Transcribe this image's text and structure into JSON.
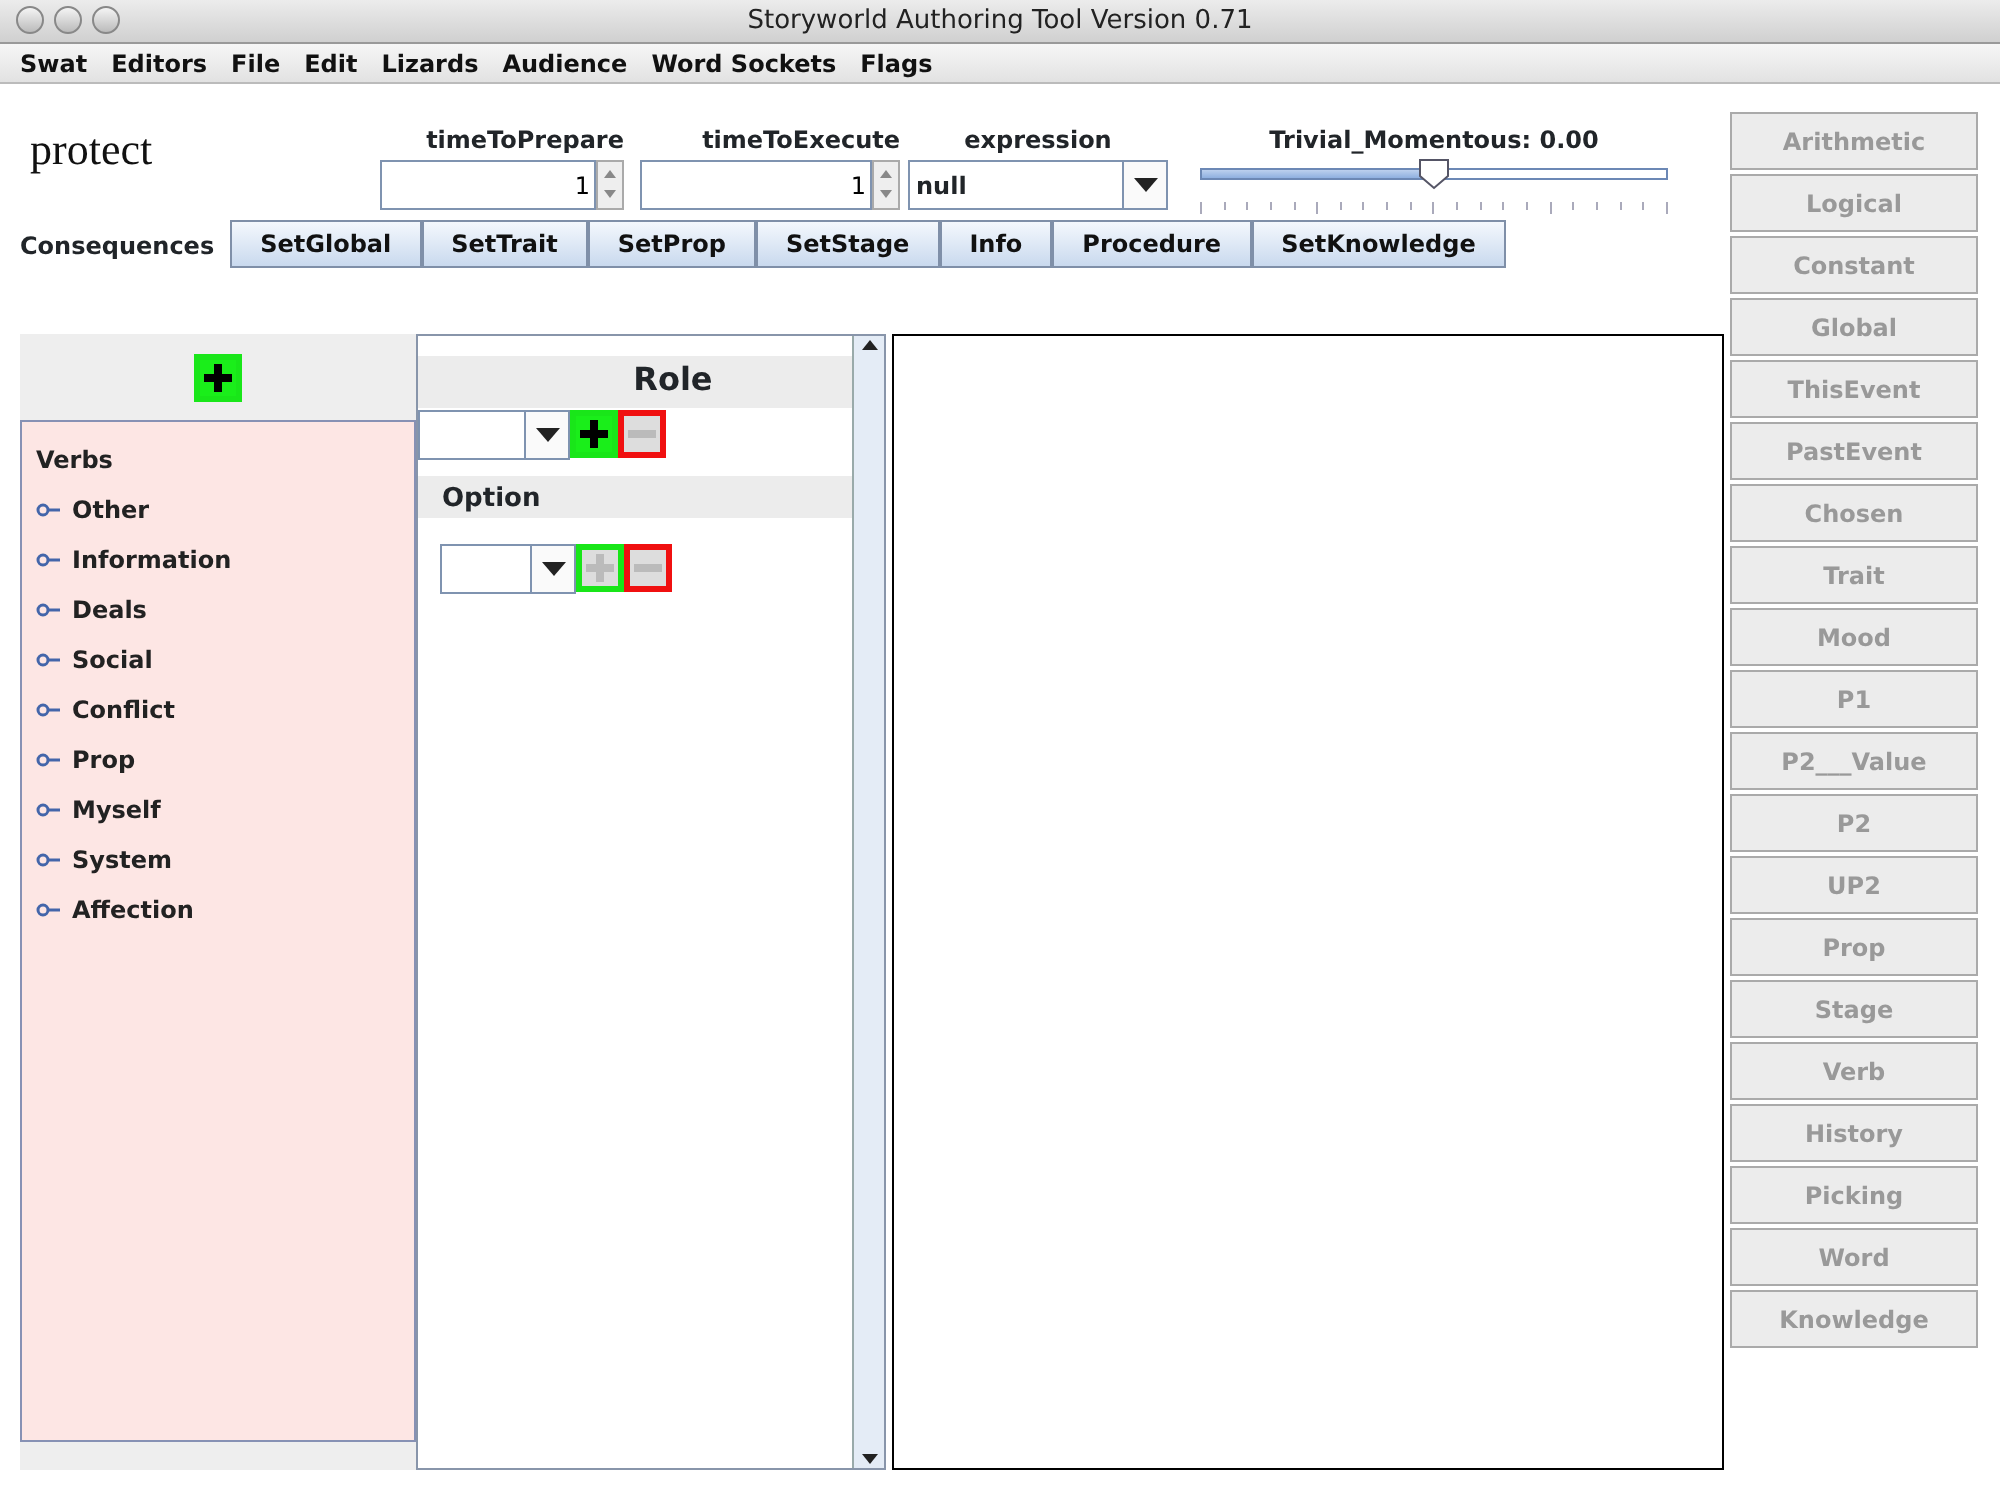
{
  "window": {
    "title": "Storyworld Authoring Tool Version 0.71"
  },
  "menu": [
    "Swat",
    "Editors",
    "File",
    "Edit",
    "Lizards",
    "Audience",
    "Word Sockets",
    "Flags"
  ],
  "verb_name": "protect",
  "fields": [
    {
      "kind": "spinner",
      "label": "timeToPrepare",
      "value": "1"
    },
    {
      "kind": "spinner",
      "label": "timeToExecute",
      "value": "1"
    },
    {
      "kind": "combo",
      "label": "expression",
      "value": "null"
    }
  ],
  "slider": {
    "label": "Trivial_Momentous: 0.00",
    "level": 0.5
  },
  "consequences": {
    "label": "Consequences",
    "buttons": [
      "SetGlobal",
      "SetTrait",
      "SetProp",
      "SetStage",
      "Info",
      "Procedure",
      "SetKnowledge"
    ]
  },
  "tree": {
    "root": "Verbs",
    "children": [
      {
        "label": "Other",
        "expanded": false
      },
      {
        "label": "Information",
        "expanded": false
      },
      {
        "label": "Deals",
        "expanded": false
      },
      {
        "label": "Social",
        "expanded": false
      },
      {
        "label": "Conflict",
        "expanded": false
      },
      {
        "label": "Prop",
        "expanded": false
      },
      {
        "label": "Myself",
        "expanded": false
      },
      {
        "label": "System",
        "expanded": false
      },
      {
        "label": "Affection",
        "expanded": false
      }
    ]
  },
  "sections": [
    {
      "title": "Role",
      "add_disabled": false,
      "remove_disabled": true
    },
    {
      "title": "Option",
      "add_disabled": true,
      "remove_disabled": true
    }
  ],
  "operators": [
    {
      "label": "Arithmetic",
      "disabled": true
    },
    {
      "label": "Logical",
      "disabled": true
    },
    {
      "label": "Constant",
      "disabled": true
    },
    {
      "label": "Global",
      "disabled": true
    },
    {
      "label": "ThisEvent",
      "disabled": true
    },
    {
      "label": "PastEvent",
      "disabled": true
    },
    {
      "label": "Chosen",
      "disabled": true
    },
    {
      "label": "Trait",
      "disabled": true
    },
    {
      "label": "Mood",
      "disabled": true
    },
    {
      "label": "P1",
      "disabled": true
    },
    {
      "label": "P2___Value",
      "disabled": true
    },
    {
      "label": "P2",
      "disabled": true
    },
    {
      "label": "UP2",
      "disabled": true
    },
    {
      "label": "Prop",
      "disabled": true
    },
    {
      "label": "Stage",
      "disabled": true
    },
    {
      "label": "Verb",
      "disabled": true
    },
    {
      "label": "History",
      "disabled": true
    },
    {
      "label": "Picking",
      "disabled": true
    },
    {
      "label": "Word",
      "disabled": true
    },
    {
      "label": "Knowledge",
      "disabled": true
    }
  ]
}
